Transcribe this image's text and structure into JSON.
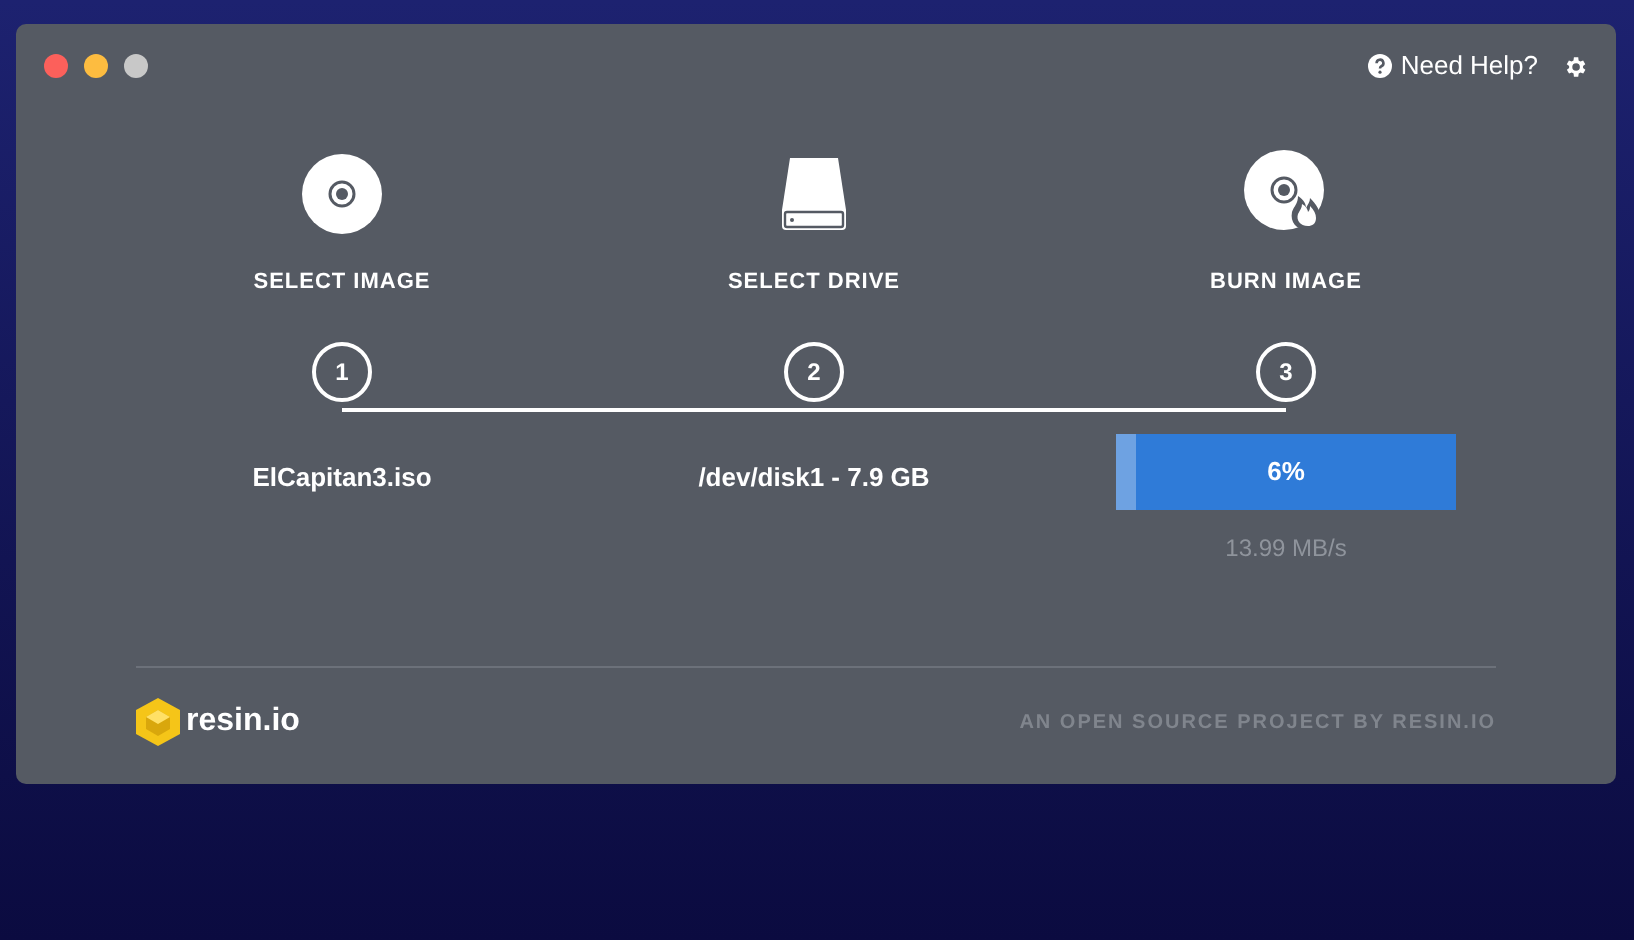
{
  "header": {
    "help": "Need Help?"
  },
  "steps": [
    {
      "kind": "image",
      "title": "SELECT IMAGE",
      "number": "1",
      "value": "ElCapitan3.iso"
    },
    {
      "kind": "drive",
      "title": "SELECT DRIVE",
      "number": "2",
      "value": "/dev/disk1 - 7.9 GB"
    },
    {
      "kind": "burn",
      "title": "BURN IMAGE",
      "number": "3",
      "progress": {
        "label": "6%",
        "level": 0.06
      },
      "speed": "13.99 MB/s"
    }
  ],
  "footer": {
    "logo": "resin.io",
    "tagline": "AN OPEN SOURCE PROJECT BY RESIN.IO"
  }
}
